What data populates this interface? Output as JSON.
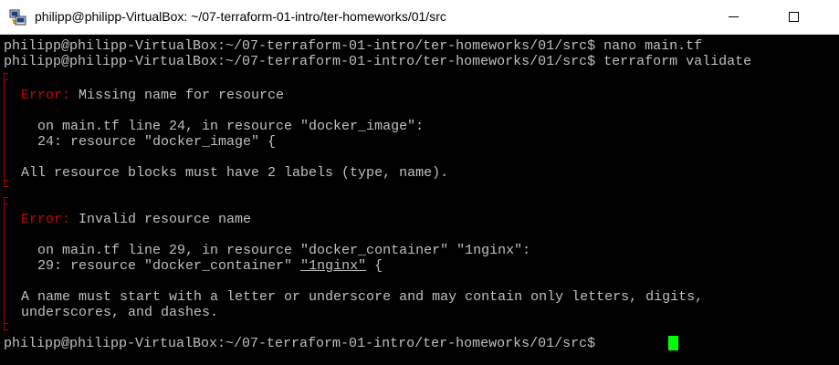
{
  "window": {
    "title": "philipp@philipp-VirtualBox: ~/07-terraform-01-intro/ter-homeworks/01/src",
    "icon": "putty-icon"
  },
  "terminal": {
    "prompt1": "philipp@philipp-VirtualBox:~/07-terraform-01-intro/ter-homeworks/01/src$ nano main.tf",
    "prompt2": "philipp@philipp-VirtualBox:~/07-terraform-01-intro/ter-homeworks/01/src$ terraform validate",
    "error1": {
      "label": "Error:",
      "title": " Missing name for resource",
      "location": "  on main.tf line 24, in resource \"docker_image\":",
      "code": "  24: resource \"docker_image\" {",
      "detail": "All resource blocks must have 2 labels (type, name)."
    },
    "error2": {
      "label": "Error:",
      "title": " Invalid resource name",
      "location": "  on main.tf line 29, in resource \"docker_container\" \"1nginx\":",
      "code_prefix": "  29: resource \"docker_container\" ",
      "code_highlight": "\"1nginx\"",
      "code_suffix": " {",
      "detail_line1": "A name must start with a letter or underscore and may contain only letters, digits,",
      "detail_line2": "underscores, and dashes."
    },
    "prompt3": "philipp@philipp-VirtualBox:~/07-terraform-01-intro/ter-homeworks/01/src$ ",
    "colors": {
      "background": "#000000",
      "text": "#c0c0c0",
      "error": "#d40000",
      "cursor": "#00ff00"
    }
  }
}
